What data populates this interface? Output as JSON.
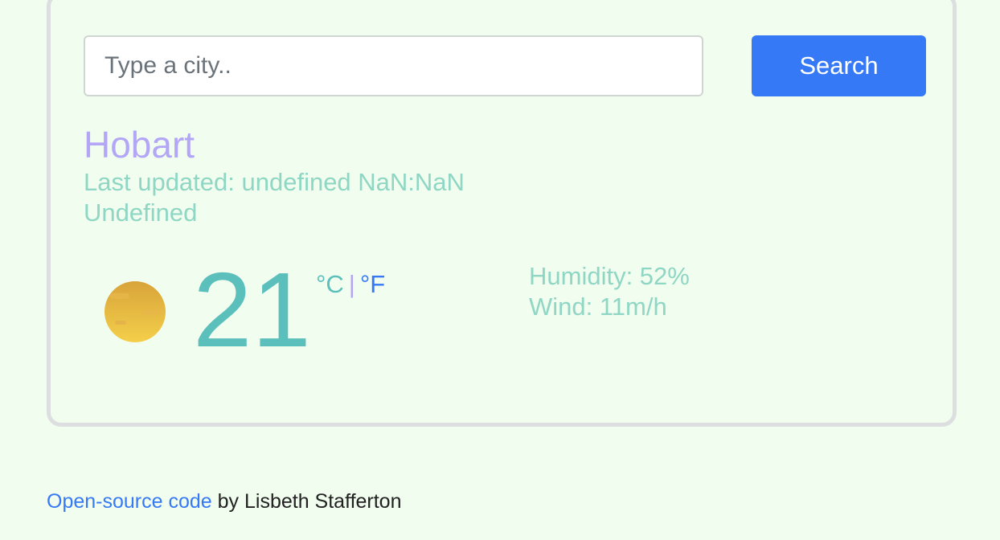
{
  "search": {
    "placeholder": "Type a city..",
    "button_label": "Search"
  },
  "weather": {
    "city": "Hobart",
    "last_updated": "Last updated: undefined NaN:NaN",
    "description": "Undefined",
    "icon": "sun-haze-icon",
    "temperature": "21",
    "unit_celsius": "°C",
    "unit_separator": "|",
    "unit_fahrenheit": "°F",
    "humidity": "Humidity: 52%",
    "wind": "Wind: 11m/h"
  },
  "footer": {
    "link_text": "Open-source code",
    "author_text": " by Lisbeth Stafferton"
  },
  "colors": {
    "background": "#f1fdef",
    "accent_blue": "#3579f6",
    "city_purple": "#b4a6f6",
    "teal_text": "#8fd7c4",
    "temperature_teal": "#5bbfbc"
  }
}
